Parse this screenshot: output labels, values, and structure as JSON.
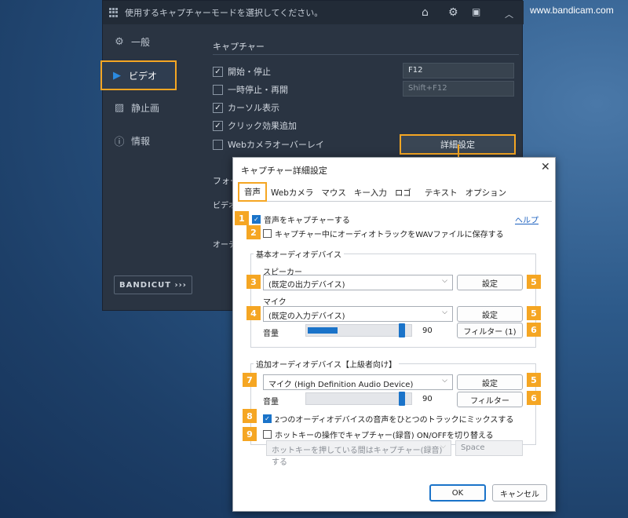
{
  "watermark": "www.bandicam.com",
  "app": {
    "top_hint": "使用するキャプチャーモードを選択してください。",
    "sidebar": {
      "items": [
        {
          "label": "一般",
          "icon": "gear-icon"
        },
        {
          "label": "ビデオ",
          "icon": "video-camera-icon"
        },
        {
          "label": "静止画",
          "icon": "image-icon"
        },
        {
          "label": "情報",
          "icon": "info-icon"
        }
      ],
      "logo": "BANDICUT ›››"
    },
    "capture": {
      "section_title": "キャプチャー",
      "options": [
        {
          "label": "開始・停止",
          "checked": true,
          "hotkey": "F12"
        },
        {
          "label": "一時停止・再開",
          "checked": false,
          "hotkey": "Shift+F12"
        },
        {
          "label": "カーソル表示",
          "checked": true
        },
        {
          "label": "クリック効果追加",
          "checked": true
        },
        {
          "label": "Webカメラオーバーレイ",
          "checked": false
        }
      ],
      "advanced_button": "詳細設定"
    },
    "format": {
      "section_title": "フォー",
      "row1": "ビデオ",
      "row2": "オーデ"
    }
  },
  "dialog": {
    "title": "キャプチャー詳細設定",
    "close": "✕",
    "tabs": [
      "音声",
      "Webカメラ",
      "マウス",
      "キー入力",
      "ロゴ",
      "テキスト",
      "オプション"
    ],
    "record_audio": {
      "label": "音声をキャプチャーする",
      "checked": true
    },
    "help": "ヘルプ",
    "save_wav": {
      "label": "キャプチャー中にオーディオトラックをWAVファイルに保存する",
      "checked": false
    },
    "basic_group": "基本オーディオデバイス",
    "speaker_label": "スピーカー",
    "speaker_value": "(既定の出力デバイス)",
    "mic_label": "マイク",
    "mic_value": "(既定の入力デバイス)",
    "settings_btn": "設定",
    "volume_label": "音量",
    "volume1": "90",
    "volume1_level": 0.35,
    "filter1_btn": "フィルター (1)",
    "extra_group": "追加オーディオデバイス【上級者向け】",
    "extra_mic_value": "マイク (High Definition Audio Device)",
    "volume2": "90",
    "filter2_btn": "フィルター",
    "mix": {
      "label": "2つのオーディオデバイスの音声をひとつのトラックにミックスする",
      "checked": true
    },
    "hotkey_toggle": {
      "label": "ホットキーの操作でキャプチャー(録音) ON/OFFを切り替える",
      "checked": false
    },
    "hotkey_mode": "ホットキーを押している間はキャプチャー(録音)する",
    "hotkey_key": "Space",
    "ok": "OK",
    "cancel": "キャンセル"
  },
  "badges": [
    "1",
    "2",
    "3",
    "4",
    "5",
    "6",
    "7",
    "8",
    "9"
  ],
  "colors": {
    "highlight": "#f5a623",
    "accent": "#1a73c9",
    "app_bg": "#2a3442"
  }
}
